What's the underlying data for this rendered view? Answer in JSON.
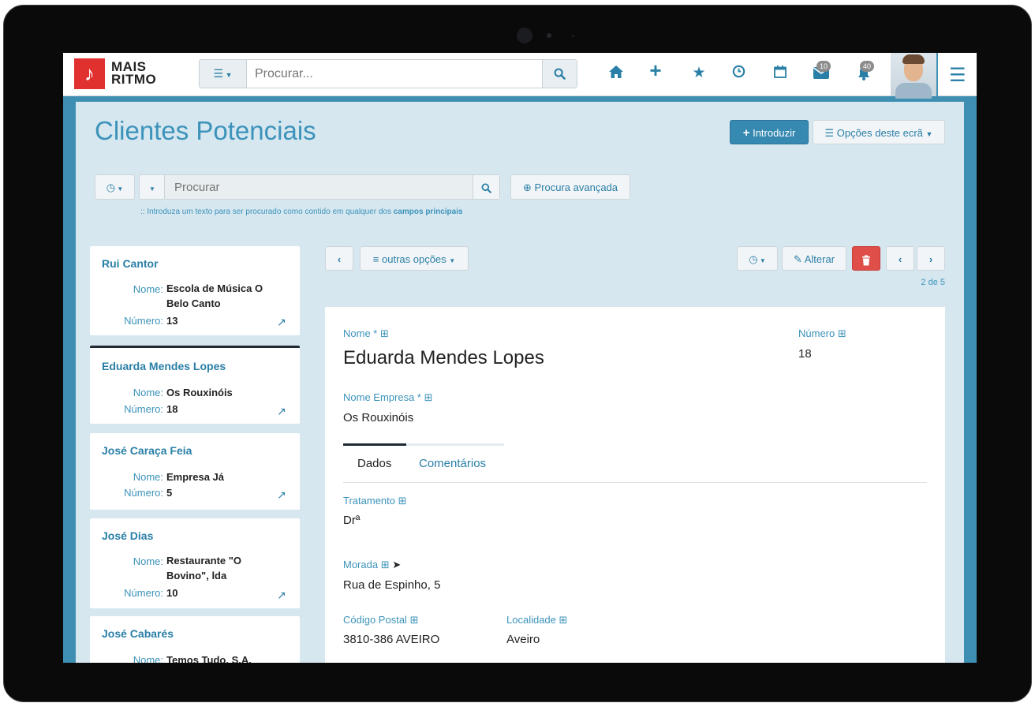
{
  "app": {
    "logo_line1": "MAIS",
    "logo_line2": "RITMO"
  },
  "topbar": {
    "search_placeholder": "Procurar...",
    "mail_count": "10",
    "notifications_count": "40"
  },
  "page": {
    "title": "Clientes Potenciais",
    "add_button": "Introduzir",
    "options_button": "Opções deste ecrã",
    "search_placeholder": "Procurar",
    "advanced_search": "Procura avançada",
    "hint_prefix": ":: Introduza um texto para ser procurado como contido em qualquer dos",
    "hint_bold": "campos principais"
  },
  "list": {
    "name_label": "Nome:",
    "number_label": "Número:",
    "items": [
      {
        "title": "Rui Cantor",
        "nome_l1": "Escola de Música O",
        "nome_l2": "Belo Canto",
        "numero": "13"
      },
      {
        "title": "Eduarda Mendes Lopes",
        "nome_l1": "Os Rouxinóis",
        "nome_l2": "",
        "numero": "18"
      },
      {
        "title": "José Caraça Feia",
        "nome_l1": "Empresa Já",
        "nome_l2": "",
        "numero": "5"
      },
      {
        "title": "José Dias",
        "nome_l1": "Restaurante \"O",
        "nome_l2": "Bovino\", lda",
        "numero": "10"
      },
      {
        "title": "José Cabarés",
        "nome_l1": "Temos Tudo, S.A.",
        "nome_l2": "",
        "numero": ""
      }
    ]
  },
  "toolbar": {
    "other_options": "outras opções",
    "edit": "Alterar",
    "pager": "2 de 5"
  },
  "detail": {
    "name_label": "Nome *",
    "name_value": "Eduarda Mendes Lopes",
    "number_label": "Número",
    "number_value": "18",
    "company_label": "Nome Empresa *",
    "company_value": "Os Rouxinóis",
    "tab_data": "Dados",
    "tab_comments": "Comentários",
    "treatment_label": "Tratamento",
    "treatment_value": "Drª",
    "address_label": "Morada",
    "address_value": "Rua de Espinho, 5",
    "postal_label": "Código Postal",
    "postal_value": "3810-386 AVEIRO",
    "locality_label": "Localidade",
    "locality_value": "Aveiro"
  },
  "colors": {
    "accent": "#3c93ba",
    "brand_red": "#e1312f",
    "danger": "#e04e49"
  }
}
